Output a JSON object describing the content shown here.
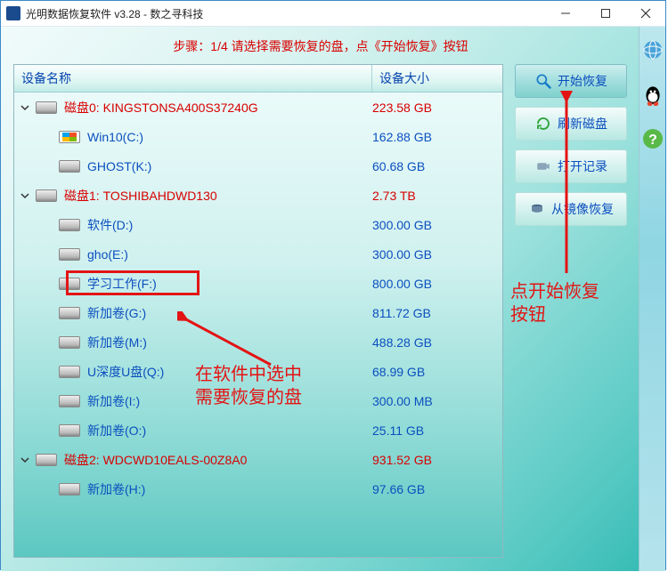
{
  "window": {
    "title": "光明数据恢复软件 v3.28 - 数之寻科技"
  },
  "step_banner": "步骤：1/4 请选择需要恢复的盘，点《开始恢复》按钮",
  "columns": {
    "c1": "设备名称",
    "c2": "设备大小"
  },
  "tree": [
    {
      "type": "disk",
      "name": "磁盘0: KINGSTONSA400S37240G",
      "size": "223.58 GB",
      "indent": 0,
      "expanded": true,
      "red": true
    },
    {
      "type": "vol",
      "name": "Win10(C:)",
      "size": "162.88 GB",
      "indent": 1,
      "icon": "win"
    },
    {
      "type": "vol",
      "name": "GHOST(K:)",
      "size": "60.68 GB",
      "indent": 1
    },
    {
      "type": "disk",
      "name": "磁盘1: TOSHIBAHDWD130",
      "size": "2.73 TB",
      "indent": 0,
      "expanded": true,
      "red": true
    },
    {
      "type": "vol",
      "name": "软件(D:)",
      "size": "300.00 GB",
      "indent": 1
    },
    {
      "type": "vol",
      "name": "gho(E:)",
      "size": "300.00 GB",
      "indent": 1
    },
    {
      "type": "vol",
      "name": "学习工作(F:)",
      "size": "800.00 GB",
      "indent": 1,
      "selected": true
    },
    {
      "type": "vol",
      "name": "新加卷(G:)",
      "size": "811.72 GB",
      "indent": 1
    },
    {
      "type": "vol",
      "name": "新加卷(M:)",
      "size": "488.28 GB",
      "indent": 1
    },
    {
      "type": "vol",
      "name": "U深度U盘(Q:)",
      "size": "68.99 GB",
      "indent": 1
    },
    {
      "type": "vol",
      "name": "新加卷(I:)",
      "size": "300.00 MB",
      "indent": 1
    },
    {
      "type": "vol",
      "name": "新加卷(O:)",
      "size": "25.11 GB",
      "indent": 1
    },
    {
      "type": "disk",
      "name": "磁盘2: WDCWD10EALS-00Z8A0",
      "size": "931.52 GB",
      "indent": 0,
      "expanded": true,
      "red": true
    },
    {
      "type": "vol",
      "name": "新加卷(H:)",
      "size": "97.66 GB",
      "indent": 1
    }
  ],
  "buttons": {
    "start": "开始恢复",
    "refresh": "刷新磁盘",
    "openlog": "打开记录",
    "image": "从镜像恢复"
  },
  "annotations": {
    "left_line1": "在软件中选中",
    "left_line2": "需要恢复的盘",
    "right_line1": "点开始恢复",
    "right_line2": "按钮"
  },
  "colors": {
    "red": "#d80000",
    "link": "#0b4fbf",
    "anno": "#e31414"
  }
}
